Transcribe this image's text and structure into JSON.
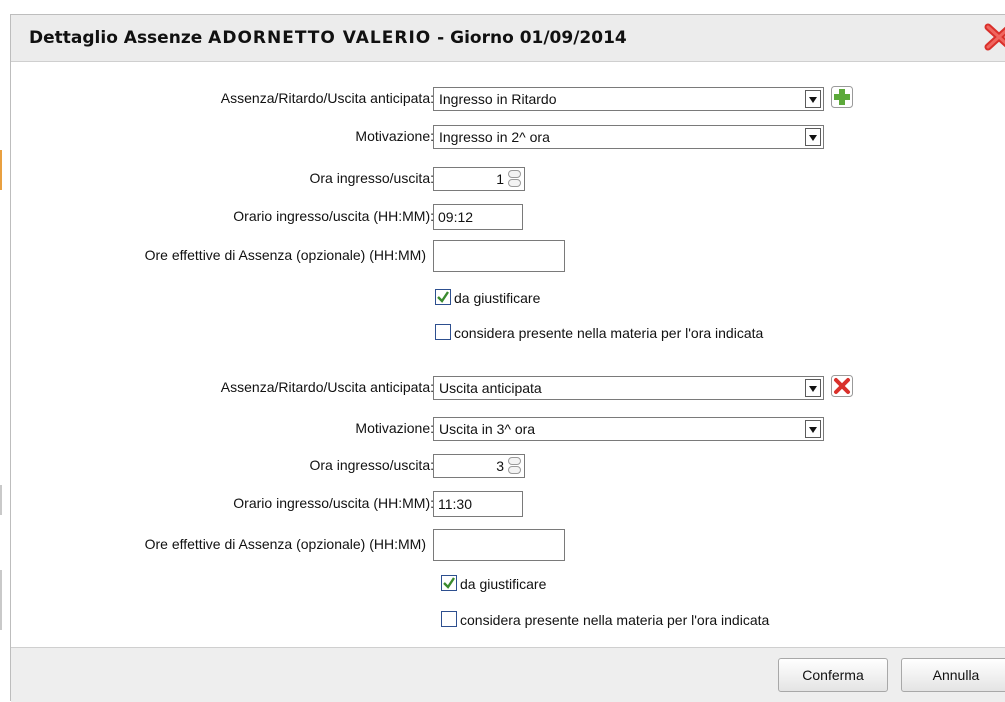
{
  "dialog": {
    "title_prefix": "Dettaglio Assenze",
    "title_redacted": "ADORNETTO VALERIO",
    "title_suffix": "- Giorno 01/09/2014"
  },
  "labels": {
    "type": "Assenza/Ritardo/Uscita anticipata:",
    "reason": "Motivazione:",
    "hour": "Ora ingresso/uscita:",
    "time": "Orario ingresso/uscita (HH:MM):",
    "effective": "Ore effettive di Assenza (opzionale) (HH:MM)",
    "justify": "da giustificare",
    "present": "considera presente nella materia per l'ora indicata"
  },
  "entries": [
    {
      "type_value": "Ingresso in Ritardo",
      "reason_value": "Ingresso in 2^ ora",
      "hour_value": "1",
      "time_value": "09:12",
      "effective_value": "",
      "justify_checked": true,
      "present_checked": false,
      "action": "add-icon"
    },
    {
      "type_value": "Uscita anticipata",
      "reason_value": "Uscita in 3^ ora",
      "hour_value": "3",
      "time_value": "11:30",
      "effective_value": "",
      "justify_checked": true,
      "present_checked": false,
      "action": "delete-icon"
    }
  ],
  "footer": {
    "confirm": "Conferma",
    "cancel": "Annulla"
  },
  "colors": {
    "add_green": "#5ca93a",
    "delete_red": "#d9302b",
    "check_green": "#3a8a2e"
  }
}
